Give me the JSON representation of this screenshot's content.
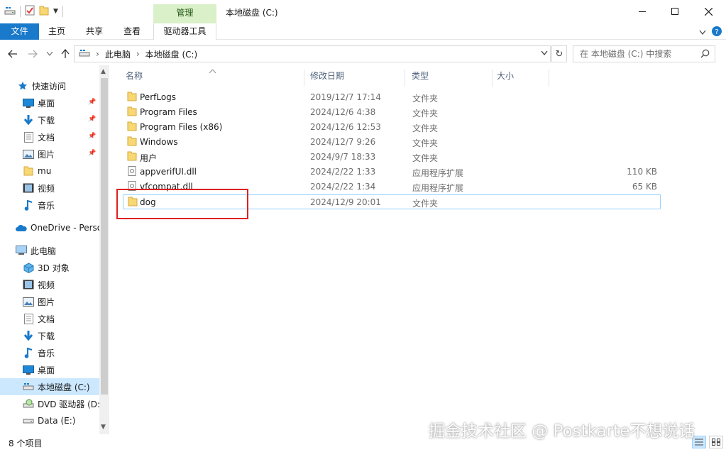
{
  "window": {
    "title": "本地磁盘 (C:)",
    "manage_tab": "管理"
  },
  "ribbon": {
    "file_tab": "文件",
    "home_tab": "主页",
    "share_tab": "共享",
    "view_tab": "查看",
    "drive_tools_tab": "驱动器工具"
  },
  "address": {
    "crumb_1": "此电脑",
    "crumb_2": "本地磁盘 (C:)",
    "search_placeholder": "在 本地磁盘 (C:) 中搜索"
  },
  "nav": {
    "quick_access": "快速访问",
    "desktop": "桌面",
    "downloads": "下载",
    "documents": "文档",
    "pictures": "图片",
    "mu": "mu",
    "videos": "视频",
    "music": "音乐",
    "onedrive": "OneDrive - Perso",
    "this_pc": "此电脑",
    "objects3d": "3D 对象",
    "pc_videos": "视频",
    "pc_pictures": "图片",
    "pc_documents": "文档",
    "pc_downloads": "下载",
    "pc_music": "音乐",
    "pc_desktop": "桌面",
    "local_disk": "本地磁盘 (C:)",
    "dvd": "DVD 驱动器 (D:",
    "data": "Data (E:)"
  },
  "columns": {
    "name": "名称",
    "date": "修改日期",
    "type": "类型",
    "size": "大小"
  },
  "files": [
    {
      "name": "PerfLogs",
      "date": "2019/12/7 17:14",
      "type": "文件夹",
      "size": ""
    },
    {
      "name": "Program Files",
      "date": "2024/12/6 4:38",
      "type": "文件夹",
      "size": ""
    },
    {
      "name": "Program Files (x86)",
      "date": "2024/12/6 12:53",
      "type": "文件夹",
      "size": ""
    },
    {
      "name": "Windows",
      "date": "2024/12/7 9:26",
      "type": "文件夹",
      "size": ""
    },
    {
      "name": "用户",
      "date": "2024/9/7 18:33",
      "type": "文件夹",
      "size": ""
    },
    {
      "name": "appverifUI.dll",
      "date": "2024/2/22 1:33",
      "type": "应用程序扩展",
      "size": "110 KB"
    },
    {
      "name": "vfcompat.dll",
      "date": "2024/2/22 1:34",
      "type": "应用程序扩展",
      "size": "65 KB"
    },
    {
      "name": "dog",
      "date": "2024/12/9 20:01",
      "type": "文件夹",
      "size": ""
    }
  ],
  "status": {
    "item_count": "8 个项目"
  },
  "watermark": "掘金技术社区 @ Postkarte不想说话",
  "colors": {
    "accent": "#1979ca",
    "selection": "#cce8ff",
    "manage_tab": "#d9f0c8",
    "folder": "#f8d775",
    "highlight_box": "#e02020"
  }
}
